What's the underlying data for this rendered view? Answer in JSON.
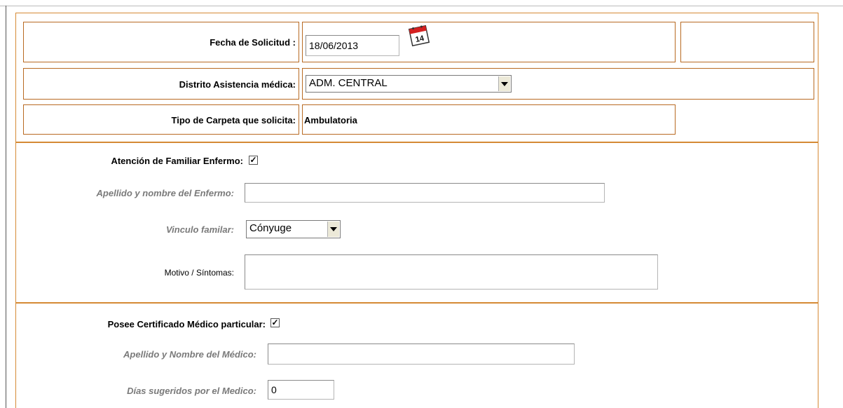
{
  "form": {
    "fecha_label": "Fecha de Solicitud :",
    "fecha_value": "18/06/2013",
    "calendar_day": "14",
    "distrito_label": "Distrito Asistencia médica:",
    "distrito_value": "ADM. CENTRAL",
    "tipo_label": "Tipo de Carpeta que solicita:",
    "tipo_value": "Ambulatoria"
  },
  "familiar": {
    "label": "Atención de Familiar Enfermo:",
    "checked": "✓",
    "apellido_label": "Apellido y nombre del Enfermo:",
    "apellido_value": "",
    "vinculo_label": "Vinculo familar:",
    "vinculo_value": "Cónyuge",
    "motivo_label": "Motivo / Síntomas:",
    "motivo_value": ""
  },
  "certificado": {
    "label": "Posee Certificado Médico particular:",
    "checked": "✓",
    "medico_label": "Apellido y Nombre del Médico:",
    "medico_value": "",
    "dias_label": "Días sugeridos por el Medico:",
    "dias_value": "0"
  }
}
